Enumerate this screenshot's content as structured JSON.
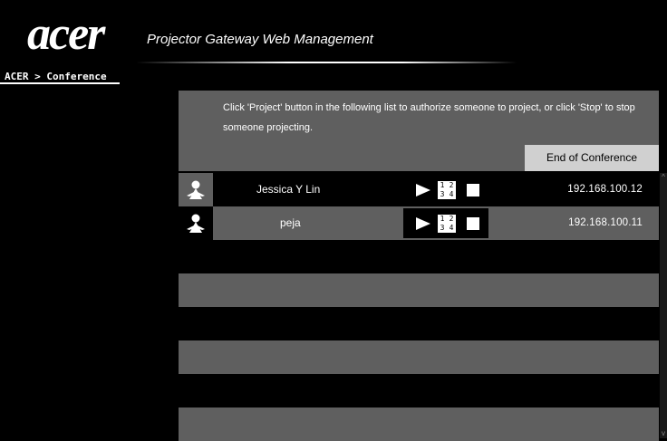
{
  "header": {
    "logo": "acer",
    "subtitle": "Projector Gateway Web Management"
  },
  "breadcrumb": "ACER > Conference",
  "instructions": {
    "text": "Click 'Project' button in the following list to authorize someone to project, or click 'Stop' to stop someone projecting."
  },
  "end_button": "End of Conference",
  "quad_labels": [
    "1",
    "2",
    "3",
    "4"
  ],
  "participants": [
    {
      "name": "Jessica Y Lin",
      "ip": "192.168.100.12"
    },
    {
      "name": "peja",
      "ip": "192.168.100.11"
    }
  ],
  "icons": {
    "user": "user-icon",
    "play": "play-icon",
    "quad": "quad-split-icon",
    "stop": "stop-icon"
  },
  "colors": {
    "background": "#000000",
    "row_gray": "#5f5f5f",
    "button_gray": "#d0d0d0"
  }
}
